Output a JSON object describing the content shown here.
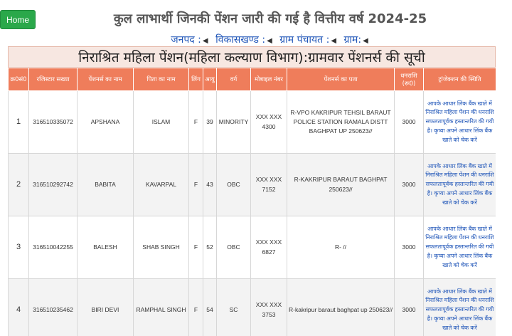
{
  "home_label": "Home",
  "page_title": "कुल लाभार्थी जिनकी पेंशन जारी की गई है वित्तीय वर्ष 2024-25",
  "filters": [
    {
      "label": "जनपद :"
    },
    {
      "label": "विकासखण्ड :"
    },
    {
      "label": "ग्राम पंचायत :"
    },
    {
      "label": "ग्राम:"
    }
  ],
  "list_title": "निराश्रित महिला पेंशन(महिला कल्याण विभाग):ग्रामवार पेंशनर्स की सूची",
  "columns": [
    "क्र0सं0",
    "रजिस्टार सख्या",
    "पेंशनर्स का नाम",
    "पिता का नाम",
    "लिंग",
    "आयु",
    "वर्ग",
    "मोबाइल नंबर",
    "पेंशनर्स का पता",
    "धनराशि (रू0)",
    "ट्रांजेक्शन की स्थिति"
  ],
  "rows": [
    {
      "sno": "1",
      "reg": "316510335072",
      "name": "APSHANA",
      "father": "ISLAM",
      "gender": "F",
      "age": "39",
      "category": "MINORITY",
      "mobile": "XXX XXX 4300",
      "address": "R-VPO KAKRIPUR TEHSIL BARAUT POLICE STATION RAMALA DISTT BAGHPAT UP 250623//",
      "amount": "3000",
      "status": "आपके आधार लिंक बैंक खाते में निराश्रित महिला पेंशन की धनराशि सफलतापूर्वक हस्तान्तरित की गयी है। कृप्या अपने आधार लिंक बैंक खाते को चेक करें"
    },
    {
      "sno": "2",
      "reg": "316510292742",
      "name": "BABITA",
      "father": "KAVARPAL",
      "gender": "F",
      "age": "43",
      "category": "OBC",
      "mobile": "XXX XXX 7152",
      "address": "R-KAKRIPUR BARAUT BAGHPAT 250623//",
      "amount": "3000",
      "status": "आपके आधार लिंक बैंक खाते में निराश्रित महिला पेंशन की धनराशि सफलतापूर्वक हस्तान्तरित की गयी है। कृप्या अपने आधार लिंक बैंक खाते को चेक करें"
    },
    {
      "sno": "3",
      "reg": "316510042255",
      "name": "BALESH",
      "father": "SHAB SINGH",
      "gender": "F",
      "age": "52",
      "category": "OBC",
      "mobile": "XXX XXX 6827",
      "address": "R- //",
      "amount": "3000",
      "status": "आपके आधार लिंक बैंक खाते में निराश्रित महिला पेंशन की धनराशि सफलतापूर्वक हस्तान्तरित की गयी है। कृप्या अपने आधार लिंक बैंक खाते को चेक करें"
    },
    {
      "sno": "4",
      "reg": "316510235462",
      "name": "BIRI DEVI",
      "father": "RAMPHAL SINGH",
      "gender": "F",
      "age": "54",
      "category": "SC",
      "mobile": "XXX XXX 3753",
      "address": "R-kakripur baraut baghpat up 250623//",
      "amount": "3000",
      "status": "आपके आधार लिंक बैंक खाते में निराश्रित महिला पेंशन की धनराशि सफलतापूर्वक हस्तान्तरित की गयी है। कृप्या अपने आधार लिंक बैंक खाते को चेक करें"
    }
  ],
  "colors": {
    "header_bg": "#ef7d5b",
    "title_bg": "#f7e7e1",
    "home_bg": "#2aa84a",
    "link": "#1f55b8"
  }
}
